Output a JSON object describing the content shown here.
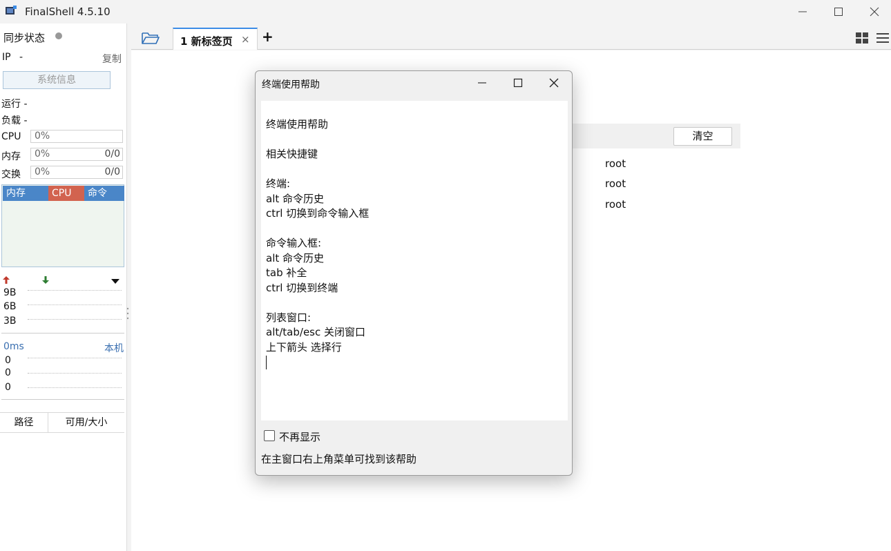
{
  "app": {
    "title": "FinalShell 4.5.10"
  },
  "sidebar": {
    "sync_label": "同步状态",
    "ip_label": "IP",
    "ip_value": "-",
    "copy_label": "复制",
    "sysinfo_label": "系统信息",
    "uptime_label": "运行 -",
    "load_label": "负载 -",
    "cpu": {
      "label": "CPU",
      "percent": "0%"
    },
    "mem": {
      "label": "内存",
      "percent": "0%",
      "value": "0/0"
    },
    "swap": {
      "label": "交换",
      "percent": "0%",
      "value": "0/0"
    },
    "process_columns": [
      "内存",
      "CPU",
      "命令"
    ],
    "net_ticks": [
      "9B",
      "6B",
      "3B"
    ],
    "ping_label": "0ms",
    "ping_target": "本机",
    "ping_ticks": [
      "0",
      "0",
      "0"
    ],
    "fs_columns": [
      "路径",
      "可用/大小"
    ]
  },
  "tabs": {
    "items": [
      {
        "label": "1 新标签页",
        "close": "×"
      }
    ],
    "add": "+"
  },
  "main": {
    "clear_label": "清空",
    "users": [
      "root",
      "root",
      "root"
    ]
  },
  "dialog": {
    "title": "终端使用帮助",
    "lines": [
      "终端使用帮助",
      "",
      "相关快捷键",
      "",
      "终端:",
      "alt 命令历史",
      "ctrl 切换到命令输入框",
      "",
      "命令输入框:",
      "alt 命令历史",
      "tab 补全",
      "ctrl 切换到终端",
      "",
      "列表窗口:",
      "alt/tab/esc 关闭窗口",
      "上下箭头 选择行"
    ],
    "checkbox_label": "不再显示",
    "checkbox_checked": false,
    "footer": "在主窗口右上角菜单可找到该帮助"
  },
  "colors": {
    "accent": "#3c8ce7",
    "cpu_header": "#d2634f",
    "mem_header": "#4a86c8",
    "up_arrow": "#c0392b",
    "down_arrow": "#2e7d32"
  }
}
